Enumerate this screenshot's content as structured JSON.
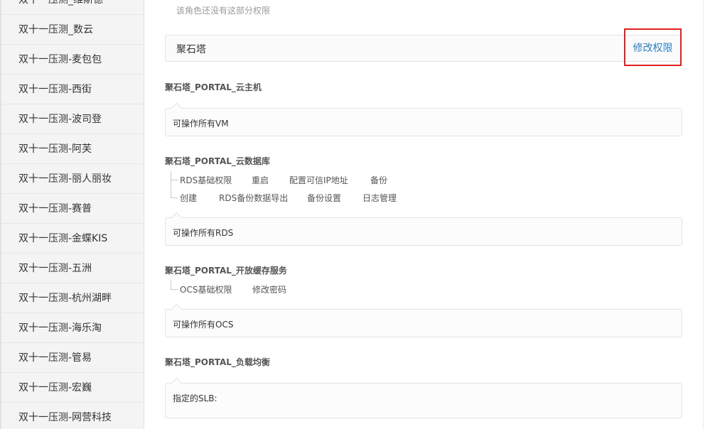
{
  "sidebar": {
    "items": [
      {
        "label": "双十一压测_维斯德"
      },
      {
        "label": "双十一压测_数云"
      },
      {
        "label": "双十一压测-麦包包"
      },
      {
        "label": "双十一压测-西街"
      },
      {
        "label": "双十一压测-波司登"
      },
      {
        "label": "双十一压测-阿芙"
      },
      {
        "label": "双十一压测-丽人丽妆"
      },
      {
        "label": "双十一压测-赛普"
      },
      {
        "label": "双十一压测-金蝶KIS"
      },
      {
        "label": "双十一压测-五洲"
      },
      {
        "label": "双十一压测-杭州湖畔"
      },
      {
        "label": "双十一压测-海乐淘"
      },
      {
        "label": "双十一压测-管易"
      },
      {
        "label": "双十一压测-宏巍"
      },
      {
        "label": "双十一压测-网营科技"
      }
    ]
  },
  "main": {
    "empty_note": "该角色还没有这部分权限",
    "role_name": "聚石塔",
    "modify_button": "修改权限",
    "groups": [
      {
        "title": "聚石塔_PORTAL_云主机",
        "tag_rows": [],
        "permission": "可操作所有VM"
      },
      {
        "title": "聚石塔_PORTAL_云数据库",
        "tag_rows": [
          [
            "RDS基础权限",
            "重启",
            "配置可信IP地址",
            "备份"
          ],
          [
            "创建",
            "RDS备份数据导出",
            "备份设置",
            "日志管理"
          ]
        ],
        "permission": "可操作所有RDS"
      },
      {
        "title": "聚石塔_PORTAL_开放缓存服务",
        "tag_rows": [
          [
            "OCS基础权限",
            "修改密码"
          ]
        ],
        "permission": "可操作所有OCS"
      },
      {
        "title": "聚石塔_PORTAL_负载均衡",
        "tag_rows": [],
        "permission": "指定的SLB:"
      }
    ]
  }
}
